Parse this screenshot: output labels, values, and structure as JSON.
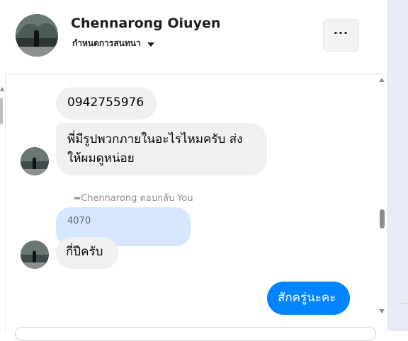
{
  "header": {
    "name": "Chennarong Oiuyen",
    "subtitle": "กำหนดการสนทนา",
    "more_label": "···"
  },
  "messages": [
    {
      "side": "incoming",
      "text": "0942755976"
    },
    {
      "side": "incoming",
      "text": "พี่มีรูปพวกภายในอะไรไหมครับ ส่งให้ผมดูหน่อย"
    },
    {
      "side": "incoming",
      "reply_label": "Chennarong ตอบกลับ You",
      "quoted_text": "4070",
      "text": "กี่ปีครับ"
    },
    {
      "side": "outgoing",
      "text": "สักครู่นะคะ"
    }
  ],
  "colors": {
    "outgoing_bubble": "#0084ff",
    "incoming_bubble": "#f0f0f0",
    "quoted_bubble": "#d6e6ff"
  },
  "icons": {
    "dropdown": "caret-down-icon",
    "reply": "reply-arrow-icon"
  }
}
